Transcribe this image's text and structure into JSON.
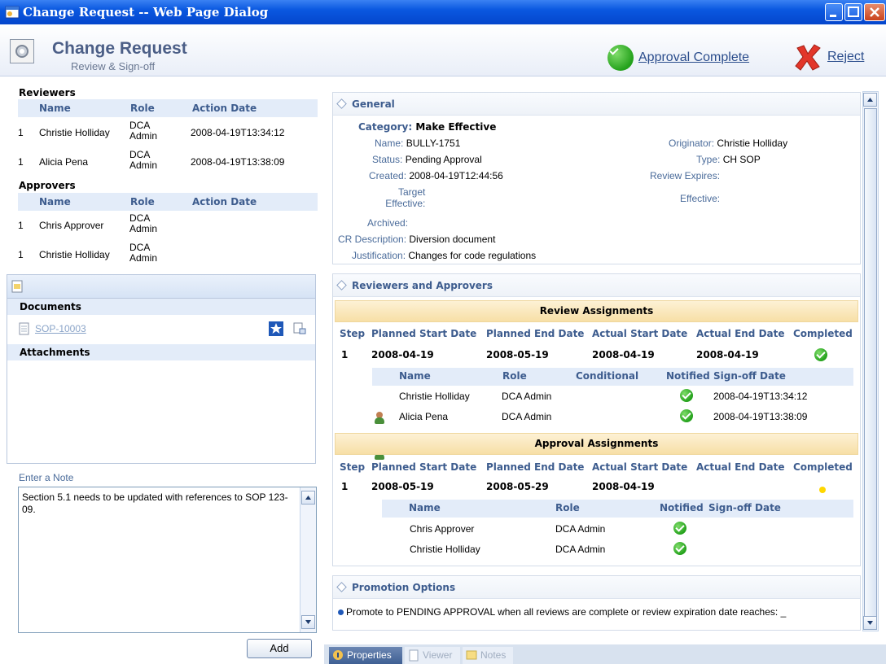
{
  "window": {
    "title": "Change Request -- Web Page Dialog"
  },
  "header": {
    "title": "Change Request",
    "subtitle": "Review & Sign-off",
    "approve_label": "Approval Complete",
    "reject_label": "Reject"
  },
  "reviewers": {
    "section_title": "Reviewers",
    "columns": [
      "Name",
      "Role",
      "Action Date"
    ],
    "rows": [
      {
        "step": "1",
        "name": "Christie Holliday",
        "role_line1": "DCA",
        "role_line2": "Admin",
        "date": "2008-04-19T13:34:12"
      },
      {
        "step": "1",
        "name": "Alicia Pena",
        "role_line1": "DCA",
        "role_line2": "Admin",
        "date": "2008-04-19T13:38:09"
      }
    ]
  },
  "approvers": {
    "section_title": "Approvers",
    "columns": [
      "Name",
      "Role",
      "Action Date"
    ],
    "rows": [
      {
        "step": "1",
        "name": "Chris Approver",
        "role_line1": "DCA",
        "role_line2": "Admin",
        "date": ""
      },
      {
        "step": "1",
        "name": "Christie Holliday",
        "role_line1": "DCA",
        "role_line2": "Admin",
        "date": ""
      }
    ]
  },
  "documents": {
    "section_title": "Documents",
    "items": [
      "SOP-10003"
    ],
    "attachments_title": "Attachments"
  },
  "note": {
    "label": "Enter a Note",
    "text": "Section 5.1 needs to be updated with references to SOP 123-09.",
    "add_label": "Add"
  },
  "general": {
    "title": "General",
    "category_label": "Category:",
    "category_value": "Make Effective",
    "name_label": "Name:",
    "name_value": "BULLY-1751",
    "status_label": "Status:",
    "status_value": "Pending Approval",
    "created_label": "Created:",
    "created_value": "2008-04-19T12:44:56",
    "target_label_1": "Target",
    "target_label_2": "Effective:",
    "archived_label": "Archived:",
    "crdesc_label": "CR Description:",
    "crdesc_value": "Diversion document",
    "justification_label": "Justification:",
    "justification_value": "Changes for code regulations",
    "originator_label": "Originator:",
    "originator_value": "Christie Holliday",
    "type_label": "Type:",
    "type_value": "CH SOP",
    "review_expires_label": "Review Expires:",
    "effective_label": "Effective:"
  },
  "rna": {
    "title": "Reviewers and Approvers",
    "step_columns": [
      "Step",
      "Planned Start Date",
      "Planned End Date",
      "Actual Start Date",
      "Actual End Date",
      "Completed"
    ],
    "review": {
      "band": "Review Assignments",
      "step": "1",
      "planned_start": "2008-04-19",
      "planned_end": "2008-05-19",
      "actual_start": "2008-04-19",
      "actual_end": "2008-04-19",
      "sub_columns": [
        "Name",
        "Role",
        "Conditional",
        "Notified",
        "Sign-off Date"
      ],
      "people": [
        {
          "name": "Christie Holliday",
          "role": "DCA Admin",
          "signoff": "2008-04-19T13:34:12"
        },
        {
          "name": "Alicia Pena",
          "role": "DCA Admin",
          "signoff": "2008-04-19T13:38:09"
        }
      ]
    },
    "approval": {
      "band": "Approval Assignments",
      "step": "1",
      "planned_start": "2008-05-19",
      "planned_end": "2008-05-29",
      "actual_start": "2008-04-19",
      "actual_end": "",
      "sub_columns": [
        "Name",
        "Role",
        "Notified",
        "Sign-off Date"
      ],
      "people": [
        {
          "name": "Chris Approver",
          "role": "DCA Admin"
        },
        {
          "name": "Christie Holliday",
          "role": "DCA Admin"
        }
      ]
    }
  },
  "promotion": {
    "title": "Promotion Options",
    "text": "Promote to PENDING APPROVAL when all reviews are complete or review expiration date reaches: _"
  },
  "tabs": [
    "Properties",
    "Viewer",
    "Notes"
  ]
}
